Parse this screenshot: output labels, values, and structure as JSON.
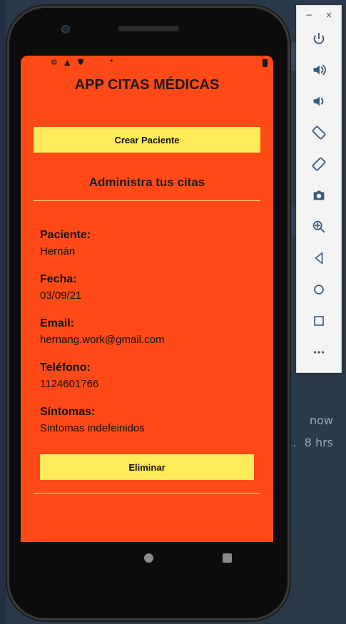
{
  "app": {
    "title": "APP CITAS MÉDICAS",
    "create_button": "Crear Paciente",
    "subtitle": "Administra tus citas"
  },
  "appointment": {
    "patient_label": "Paciente:",
    "patient_value": "Hernán",
    "date_label": "Fecha:",
    "date_value": "03/09/21",
    "email_label": "Email:",
    "email_value": "hernang.work@gmail.com",
    "phone_label": "Teléfono:",
    "phone_value": "1124601766",
    "symptoms_label": "Síntomas:",
    "symptoms_value": "Sintomas indefeinidos",
    "delete_button": "Eliminar"
  },
  "background": {
    "time_now": "now",
    "time_8hrs": "8 hrs",
    "ellipsis": ".."
  },
  "colors": {
    "screen_bg": "#ff4a17",
    "button_bg": "#ffeb57",
    "rule": "#ffe28a"
  },
  "toolbar": {
    "minimize": "−",
    "close": "×",
    "buttons": [
      "power-icon",
      "volume-up-icon",
      "volume-down-icon",
      "rotate-left-icon",
      "rotate-right-icon",
      "camera-icon",
      "zoom-icon",
      "back-icon",
      "home-icon",
      "overview-icon",
      "more-icon"
    ]
  }
}
